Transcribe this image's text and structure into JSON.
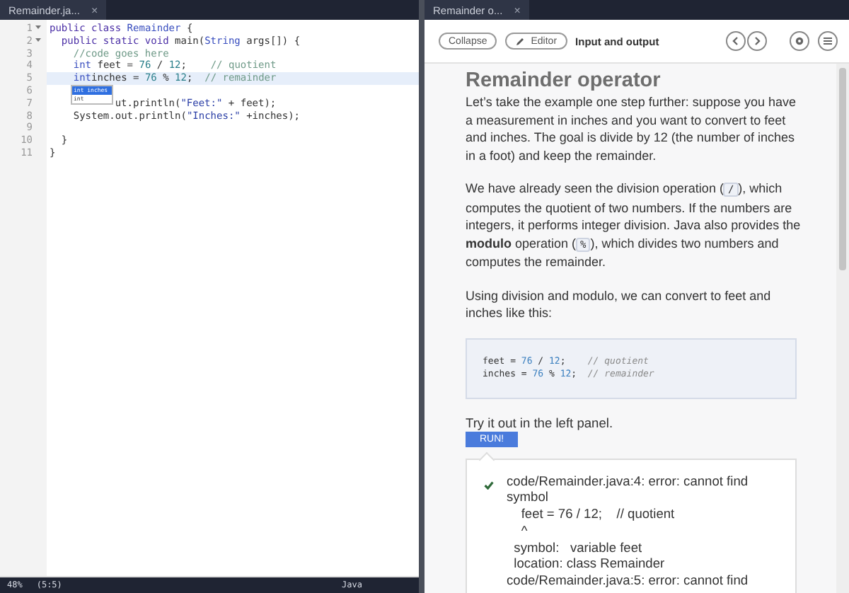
{
  "editor": {
    "tab": {
      "label": "Remainder.ja...",
      "close": "×"
    },
    "lines": [
      {
        "number": "1",
        "foldable": true,
        "current": false,
        "tokens": [
          {
            "kind": "keyword",
            "text": "public class "
          },
          {
            "kind": "type",
            "text": "Remainder"
          },
          {
            "kind": "plain",
            "text": " {"
          }
        ]
      },
      {
        "number": "2",
        "foldable": true,
        "current": false,
        "tokens": [
          {
            "kind": "keyword",
            "text": "  public static void "
          },
          {
            "kind": "plain",
            "text": "main("
          },
          {
            "kind": "type",
            "text": "String"
          },
          {
            "kind": "plain",
            "text": " args[]) {"
          }
        ]
      },
      {
        "number": "3",
        "foldable": false,
        "current": false,
        "tokens": [
          {
            "kind": "comment",
            "text": "    //code goes here"
          }
        ]
      },
      {
        "number": "4",
        "foldable": false,
        "current": false,
        "tokens": [
          {
            "kind": "type",
            "text": "    int"
          },
          {
            "kind": "plain",
            "text": " feet = "
          },
          {
            "kind": "number",
            "text": "76"
          },
          {
            "kind": "plain",
            "text": " / "
          },
          {
            "kind": "number",
            "text": "12"
          },
          {
            "kind": "plain",
            "text": ";    "
          },
          {
            "kind": "comment",
            "text": "// quotient"
          }
        ]
      },
      {
        "number": "5",
        "foldable": false,
        "current": true,
        "tokens": [
          {
            "kind": "type",
            "text": "    int"
          },
          {
            "kind": "plain",
            "text": "inches = "
          },
          {
            "kind": "number",
            "text": "76"
          },
          {
            "kind": "plain",
            "text": " % "
          },
          {
            "kind": "number",
            "text": "12"
          },
          {
            "kind": "plain",
            "text": ";  "
          },
          {
            "kind": "comment",
            "text": "// remainder"
          }
        ]
      },
      {
        "number": "6",
        "foldable": false,
        "current": false
      },
      {
        "number": "7",
        "foldable": false,
        "current": false,
        "tokens": [
          {
            "kind": "plain",
            "text": "ut.println("
          },
          {
            "kind": "string",
            "text": "\"Feet:\""
          },
          {
            "kind": "plain",
            "text": " + feet);"
          }
        ]
      },
      {
        "number": "8",
        "foldable": false,
        "current": false,
        "tokens": [
          {
            "kind": "plain",
            "text": "    System.out.println("
          },
          {
            "kind": "string",
            "text": "\"Inches:\""
          },
          {
            "kind": "plain",
            "text": " +inches);"
          }
        ]
      },
      {
        "number": "9",
        "foldable": false,
        "current": false
      },
      {
        "number": "10",
        "foldable": false,
        "current": false,
        "tokens": [
          {
            "kind": "plain",
            "text": "  }"
          }
        ]
      },
      {
        "number": "11",
        "foldable": false,
        "current": false,
        "tokens": [
          {
            "kind": "plain",
            "text": "}"
          }
        ]
      }
    ],
    "autocomplete": [
      {
        "label": "int inches",
        "selected": true
      },
      {
        "label": "int",
        "selected": false
      }
    ]
  },
  "status_bar": {
    "zoom": "48%",
    "cursor": "(5:5)",
    "language": "Java"
  },
  "lesson": {
    "tab": {
      "label": "Remainder o...",
      "close": "×"
    },
    "toolbar": {
      "collapse": "Collapse",
      "editor": "Editor",
      "section": "Input and output"
    },
    "title": "Remainder operator",
    "paragraphs": [
      [
        {
          "kind": "text",
          "text": "Let’s take the example one step further: suppose you have a measurement in inches and you want to convert to feet and inches. The goal is divide by 12 (the number of inches in a foot) and keep the remainder."
        }
      ],
      [
        {
          "kind": "text",
          "text": "We have already seen the division operation ("
        },
        {
          "kind": "code",
          "text": "/"
        },
        {
          "kind": "text",
          "text": "), which computes the quotient of two numbers. If the numbers are integers, it performs integer division. Java also provides the **modulo** operation ("
        },
        {
          "kind": "code",
          "text": "%"
        },
        {
          "kind": "text",
          "text": "), which divides two numbers and computes the remainder."
        }
      ],
      [
        {
          "kind": "text",
          "text": "Using division and modulo, we can convert to feet and inches like this:"
        }
      ]
    ],
    "code_block": [
      [
        {
          "kind": "plain",
          "text": "feet = "
        },
        {
          "kind": "number",
          "text": "76"
        },
        {
          "kind": "plain",
          "text": " / "
        },
        {
          "kind": "number",
          "text": "12"
        },
        {
          "kind": "plain",
          "text": ";    "
        },
        {
          "kind": "comment",
          "text": "// quotient"
        }
      ],
      [
        {
          "kind": "plain",
          "text": "inches = "
        },
        {
          "kind": "number",
          "text": "76"
        },
        {
          "kind": "plain",
          "text": " % "
        },
        {
          "kind": "number",
          "text": "12"
        },
        {
          "kind": "plain",
          "text": ";  "
        },
        {
          "kind": "comment",
          "text": "// remainder"
        }
      ]
    ],
    "try_text": "Try it out in the left panel.",
    "run_button": "RUN!",
    "output": {
      "success": true,
      "lines": [
        "code/Remainder.java:4: error: cannot find",
        "symbol",
        "    feet = 76 / 12;    // quotient",
        "    ^",
        "  symbol:   variable feet",
        "  location: class Remainder",
        "code/Remainder.java:5: error: cannot find"
      ]
    }
  }
}
